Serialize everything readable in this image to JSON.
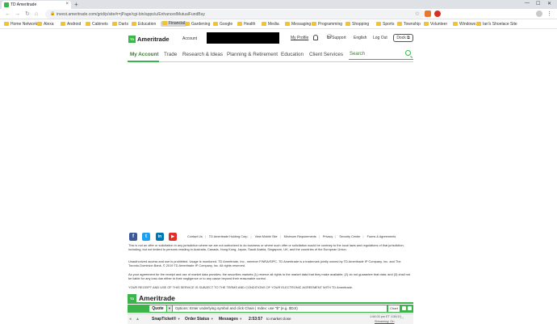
{
  "browser": {
    "tab_title": "TD Ameritrade",
    "url": "invest.ameritrade.com/grid/p/site#r=jPage/cgi-bin/apps/u/EnhancedMutualFundBuy",
    "new_tab": "+",
    "close_tab": "×"
  },
  "bookmarks": [
    {
      "label": "Home Network",
      "active": false
    },
    {
      "label": "Alexa",
      "active": false
    },
    {
      "label": "Android",
      "active": false
    },
    {
      "label": "Cabinets",
      "active": false
    },
    {
      "label": "Darts",
      "active": false
    },
    {
      "label": "Education",
      "active": false
    },
    {
      "label": "Financial",
      "active": true
    },
    {
      "label": "Gardening",
      "active": false
    },
    {
      "label": "Google",
      "active": false
    },
    {
      "label": "Health",
      "active": false
    },
    {
      "label": "Media",
      "active": false
    },
    {
      "label": "Messaging",
      "active": false
    },
    {
      "label": "Programming",
      "active": false
    },
    {
      "label": "Shopping",
      "active": false
    },
    {
      "label": "Sports",
      "active": false
    },
    {
      "label": "Township",
      "active": false
    },
    {
      "label": "Volunteer",
      "active": false
    },
    {
      "label": "Windows",
      "active": false
    },
    {
      "label": "Ian's Shoelace Site",
      "active": false
    }
  ],
  "header": {
    "logo_mark": "TD",
    "logo_text": "Ameritrade",
    "account_label": "Account",
    "my_profile": "My Profile",
    "hi_support": "Hi Support",
    "language": "English",
    "log_out": "Log Out",
    "dock": "Dock"
  },
  "nav": {
    "items": [
      "My Account",
      "Trade",
      "Research & Ideas",
      "Planning & Retirement",
      "Education",
      "Client Services"
    ],
    "search_placeholder": "Search"
  },
  "footer": {
    "social": [
      "f",
      "t",
      "in",
      "▶"
    ],
    "links": [
      "Contact Us",
      "TD Ameritrade Holding Corp.",
      "View Mobile Site",
      "Minimum Requirements",
      "Privacy",
      "Security Center",
      "Forms & Agreements"
    ],
    "para1": "This is not an offer or solicitation in any jurisdiction where we are not authorized to do business or where such offer or solicitation would be contrary to the local laws and regulations of that jurisdiction, including, but not limited to persons residing in Australia, Canada, Hong Kong, Japan, Saudi Arabia, Singapore, UK, and the countries of the European Union.",
    "para2": "Unauthorized access and use is prohibited. Usage is monitored. TD Ameritrade, Inc., member FINRA/SIPC. TD Ameritrade is a trademark jointly owned by TD Ameritrade IP Company, Inc. and The Toronto-Dominion Bank. © 2019 TD Ameritrade IP Company, Inc. All rights reserved.",
    "para3": "As your agreement for the receipt and use of market data provides, the securities markets (1) reserve all rights to the market data that they make available; (2) do not guarantee that data; and (3) shall not be liable for any loss due either to their negligence or to any cause beyond their reasonable control.",
    "para4": "YOUR RECEIPT AND USE OF THIS SERVICE IS SUBJECT TO THE TERMS AND CONDITIONS OF YOUR ELECTRONIC AGREEMENT WITH TD Ameritrade."
  },
  "quotebar": {
    "logo_mark": "TD",
    "logo_text": "Ameritrade",
    "quote_label": "Quote",
    "input_placeholder": "Options: Enter underlying symbol and click Chain | Index: use \"$\" (e.g. $DJI)",
    "chart_label": "Chart"
  },
  "ticketbar": {
    "snapticket": "SnapTicket®",
    "order_status": "Order Status",
    "messages": "Messages",
    "countdown": "2:53:57",
    "countdown_suffix": "to market close",
    "timestamp": "1:06:03 pm ET 1/30/19",
    "streaming": "Streaming: On"
  }
}
